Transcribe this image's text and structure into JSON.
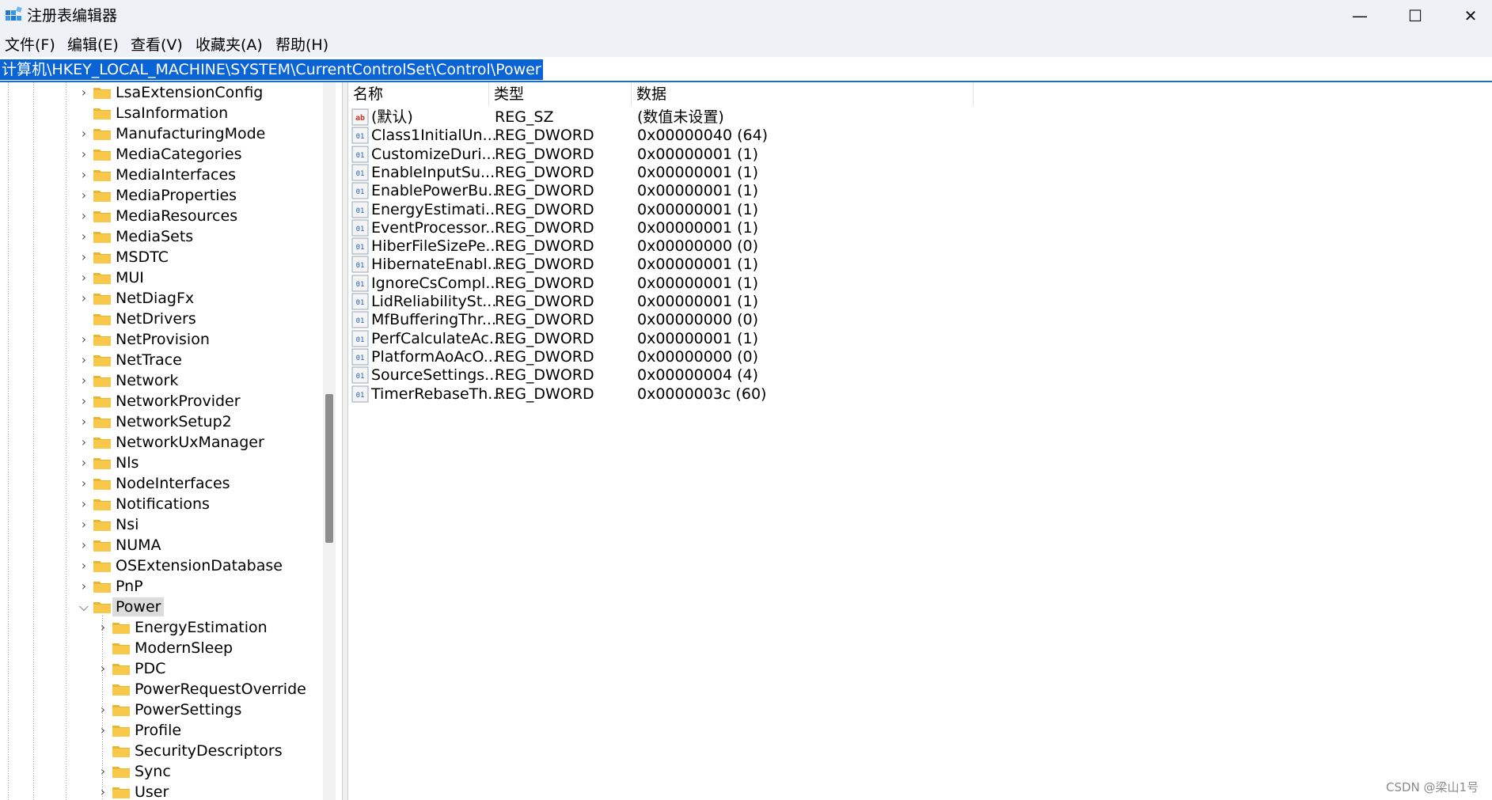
{
  "window": {
    "title": "注册表编辑器",
    "minimize_glyph": "—",
    "maximize_glyph": "☐",
    "close_glyph": "✕"
  },
  "menu": [
    "文件(F)",
    "编辑(E)",
    "查看(V)",
    "收藏夹(A)",
    "帮助(H)"
  ],
  "address": "计算机\\HKEY_LOCAL_MACHINE\\SYSTEM\\CurrentControlSet\\Control\\Power",
  "tree": {
    "items": [
      {
        "label": "LsaExtensionConfig",
        "expandable": true,
        "level": 0
      },
      {
        "label": "LsaInformation",
        "expandable": false,
        "level": 0
      },
      {
        "label": "ManufacturingMode",
        "expandable": true,
        "level": 0
      },
      {
        "label": "MediaCategories",
        "expandable": true,
        "level": 0
      },
      {
        "label": "MediaInterfaces",
        "expandable": true,
        "level": 0
      },
      {
        "label": "MediaProperties",
        "expandable": true,
        "level": 0
      },
      {
        "label": "MediaResources",
        "expandable": true,
        "level": 0
      },
      {
        "label": "MediaSets",
        "expandable": true,
        "level": 0
      },
      {
        "label": "MSDTC",
        "expandable": true,
        "level": 0
      },
      {
        "label": "MUI",
        "expandable": true,
        "level": 0
      },
      {
        "label": "NetDiagFx",
        "expandable": true,
        "level": 0
      },
      {
        "label": "NetDrivers",
        "expandable": false,
        "level": 0
      },
      {
        "label": "NetProvision",
        "expandable": true,
        "level": 0
      },
      {
        "label": "NetTrace",
        "expandable": true,
        "level": 0
      },
      {
        "label": "Network",
        "expandable": true,
        "level": 0
      },
      {
        "label": "NetworkProvider",
        "expandable": true,
        "level": 0
      },
      {
        "label": "NetworkSetup2",
        "expandable": true,
        "level": 0
      },
      {
        "label": "NetworkUxManager",
        "expandable": true,
        "level": 0
      },
      {
        "label": "Nls",
        "expandable": true,
        "level": 0
      },
      {
        "label": "NodeInterfaces",
        "expandable": true,
        "level": 0
      },
      {
        "label": "Notifications",
        "expandable": true,
        "level": 0
      },
      {
        "label": "Nsi",
        "expandable": true,
        "level": 0
      },
      {
        "label": "NUMA",
        "expandable": true,
        "level": 0
      },
      {
        "label": "OSExtensionDatabase",
        "expandable": true,
        "level": 0
      },
      {
        "label": "PnP",
        "expandable": true,
        "level": 0
      },
      {
        "label": "Power",
        "expandable": true,
        "expanded": true,
        "selected": true,
        "level": 0
      },
      {
        "label": "EnergyEstimation",
        "expandable": true,
        "level": 1
      },
      {
        "label": "ModernSleep",
        "expandable": false,
        "level": 1
      },
      {
        "label": "PDC",
        "expandable": true,
        "level": 1
      },
      {
        "label": "PowerRequestOverride",
        "expandable": false,
        "level": 1
      },
      {
        "label": "PowerSettings",
        "expandable": true,
        "level": 1
      },
      {
        "label": "Profile",
        "expandable": true,
        "level": 1
      },
      {
        "label": "SecurityDescriptors",
        "expandable": false,
        "level": 1
      },
      {
        "label": "Sync",
        "expandable": true,
        "level": 1
      },
      {
        "label": "User",
        "expandable": true,
        "level": 1
      }
    ]
  },
  "values": {
    "headers": {
      "name": "名称",
      "type": "类型",
      "data": "数据"
    },
    "rows": [
      {
        "icon": "string-value-icon",
        "name": "(默认)",
        "type": "REG_SZ",
        "data": "(数值未设置)"
      },
      {
        "icon": "binary-value-icon",
        "name": "Class1InitialUn...",
        "type": "REG_DWORD",
        "data": "0x00000040 (64)"
      },
      {
        "icon": "binary-value-icon",
        "name": "CustomizeDuri...",
        "type": "REG_DWORD",
        "data": "0x00000001 (1)"
      },
      {
        "icon": "binary-value-icon",
        "name": "EnableInputSu...",
        "type": "REG_DWORD",
        "data": "0x00000001 (1)"
      },
      {
        "icon": "binary-value-icon",
        "name": "EnablePowerBu...",
        "type": "REG_DWORD",
        "data": "0x00000001 (1)"
      },
      {
        "icon": "binary-value-icon",
        "name": "EnergyEstimati...",
        "type": "REG_DWORD",
        "data": "0x00000001 (1)"
      },
      {
        "icon": "binary-value-icon",
        "name": "EventProcessor...",
        "type": "REG_DWORD",
        "data": "0x00000001 (1)"
      },
      {
        "icon": "binary-value-icon",
        "name": "HiberFileSizePe...",
        "type": "REG_DWORD",
        "data": "0x00000000 (0)"
      },
      {
        "icon": "binary-value-icon",
        "name": "HibernateEnabl...",
        "type": "REG_DWORD",
        "data": "0x00000001 (1)"
      },
      {
        "icon": "binary-value-icon",
        "name": "IgnoreCsCompl...",
        "type": "REG_DWORD",
        "data": "0x00000001 (1)"
      },
      {
        "icon": "binary-value-icon",
        "name": "LidReliabilitySt...",
        "type": "REG_DWORD",
        "data": "0x00000001 (1)"
      },
      {
        "icon": "binary-value-icon",
        "name": "MfBufferingThr...",
        "type": "REG_DWORD",
        "data": "0x00000000 (0)"
      },
      {
        "icon": "binary-value-icon",
        "name": "PerfCalculateAc...",
        "type": "REG_DWORD",
        "data": "0x00000001 (1)"
      },
      {
        "icon": "binary-value-icon",
        "name": "PlatformAoAcO...",
        "type": "REG_DWORD",
        "data": "0x00000000 (0)"
      },
      {
        "icon": "binary-value-icon",
        "name": "SourceSettings...",
        "type": "REG_DWORD",
        "data": "0x00000004 (4)"
      },
      {
        "icon": "binary-value-icon",
        "name": "TimerRebaseTh...",
        "type": "REG_DWORD",
        "data": "0x0000003c (60)"
      }
    ]
  },
  "watermark": "CSDN @梁山1号",
  "colors": {
    "accent": "#0a64d6",
    "folder": "#f8c84a",
    "titlebar": "#eef1f6"
  }
}
